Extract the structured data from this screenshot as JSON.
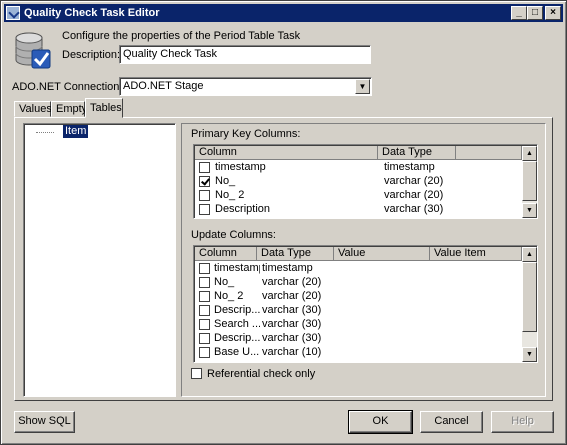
{
  "window": {
    "title": "Quality Check Task Editor",
    "min_label": "_",
    "max_label": "□",
    "close_label": "×"
  },
  "header": {
    "configure_text": "Configure the properties of the Period Table Task",
    "description_label": "Description:",
    "description_value": "Quality Check Task"
  },
  "connection": {
    "label": "ADO.NET Connection:",
    "value": "ADO.NET Stage"
  },
  "tabs": [
    {
      "label": "Values"
    },
    {
      "label": "Empty"
    },
    {
      "label": "Tables"
    }
  ],
  "tree": {
    "node_label": "Item"
  },
  "primary_key": {
    "title": "Primary Key Columns:",
    "headers": [
      "Column",
      "Data Type"
    ],
    "rows": [
      {
        "checked": false,
        "column": "timestamp",
        "type": "timestamp"
      },
      {
        "checked": true,
        "column": "No_",
        "type": "varchar (20)"
      },
      {
        "checked": false,
        "column": "No_ 2",
        "type": "varchar (20)"
      },
      {
        "checked": false,
        "column": "Description",
        "type": "varchar (30)"
      }
    ]
  },
  "update_columns": {
    "title": "Update Columns:",
    "headers": [
      "Column",
      "Data Type",
      "Value",
      "Value Item"
    ],
    "rows": [
      {
        "checked": false,
        "column": "timestamp",
        "type": "timestamp"
      },
      {
        "checked": false,
        "column": "No_",
        "type": "varchar (20)"
      },
      {
        "checked": false,
        "column": "No_ 2",
        "type": "varchar (20)"
      },
      {
        "checked": false,
        "column": "Descrip...",
        "type": "varchar (30)"
      },
      {
        "checked": false,
        "column": "Search ...",
        "type": "varchar (30)"
      },
      {
        "checked": false,
        "column": "Descrip...",
        "type": "varchar (30)"
      },
      {
        "checked": false,
        "column": "Base U...",
        "type": "varchar (10)"
      }
    ]
  },
  "referential": {
    "label": "Referential check only",
    "checked": false
  },
  "buttons": {
    "show_sql": "Show SQL",
    "ok": "OK",
    "cancel": "Cancel",
    "help": "Help"
  },
  "scroll": {
    "up": "▲",
    "down": "▼"
  }
}
